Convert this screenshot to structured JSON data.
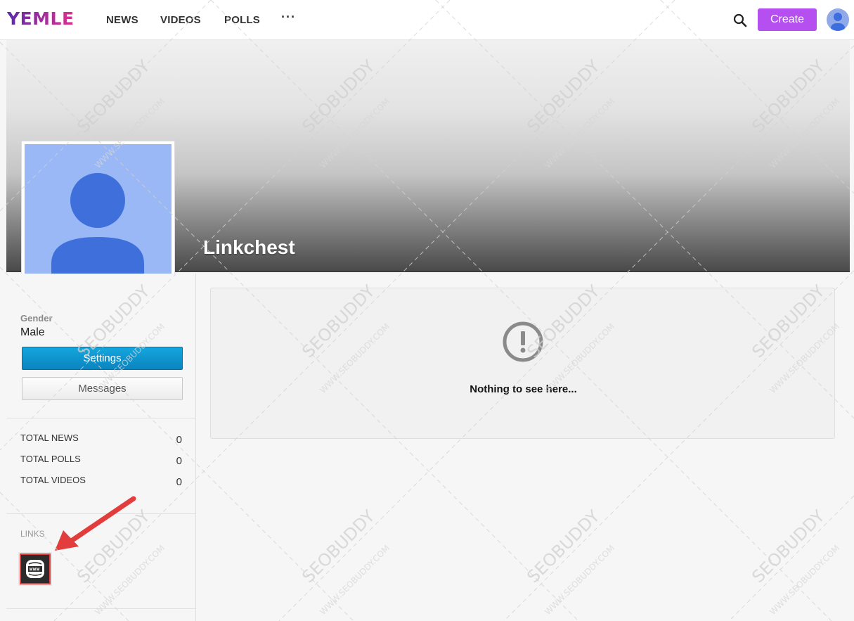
{
  "header": {
    "logo": "YEMLE",
    "nav": [
      "NEWS",
      "VIDEOS",
      "POLLS"
    ],
    "more": "···",
    "create_label": "Create",
    "logo_gradient": [
      "#5b2ba8",
      "#e0308f"
    ],
    "create_color": "#b64ff0"
  },
  "profile": {
    "name": "Linkchest",
    "gender_label": "Gender",
    "gender_value": "Male",
    "settings_label": "Settings",
    "messages_label": "Messages"
  },
  "stats": [
    {
      "label": "TOTAL NEWS",
      "value": "0"
    },
    {
      "label": "TOTAL POLLS",
      "value": "0"
    },
    {
      "label": "TOTAL VIDEOS",
      "value": "0"
    }
  ],
  "links": {
    "label": "LINKS",
    "icon": "www-globe-icon"
  },
  "empty_state": {
    "icon": "exclamation-circle-icon",
    "text": "Nothing to see here..."
  },
  "watermark": {
    "brand": "SEOBUDDY",
    "url": "WWW.SEOBUDDY.COM"
  }
}
